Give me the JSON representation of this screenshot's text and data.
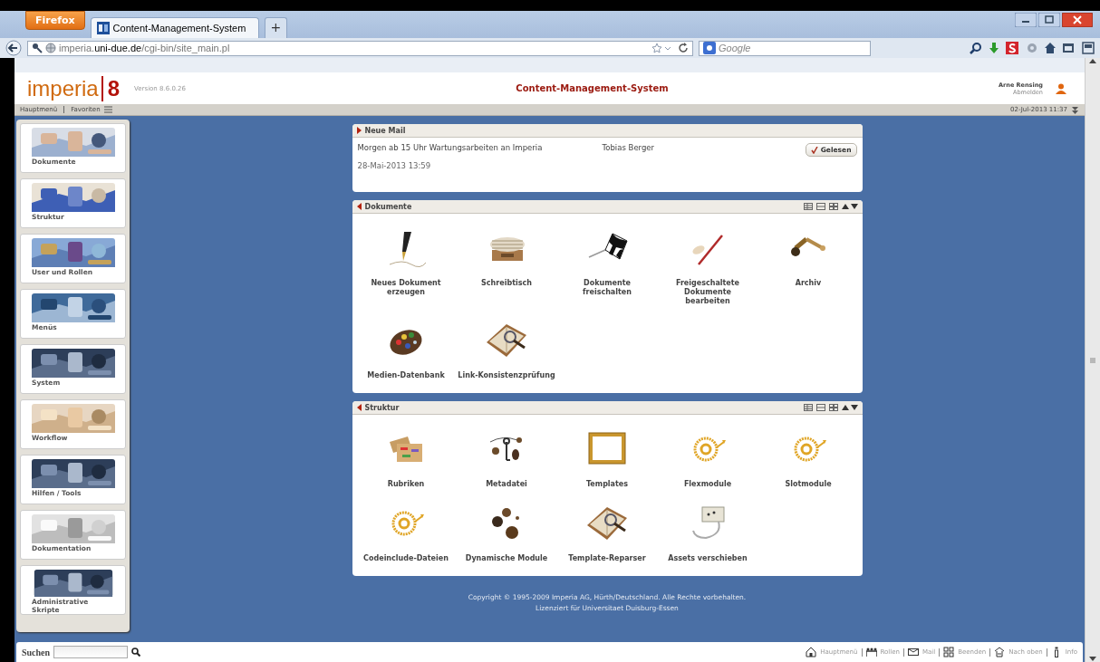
{
  "browser": {
    "menu_button": "Firefox",
    "tab_title": "Content-Management-System",
    "new_tab": "+",
    "url_host": "imperia.",
    "url_domain": "uni-due.de",
    "url_path": "/cgi-bin/site_main.pl",
    "search_placeholder": "Google"
  },
  "header": {
    "logo": "imperia",
    "logo_version": "8",
    "version": "Version 8.6.0.26",
    "title": "Content-Management-System",
    "user": "Arne Rensing",
    "logout": "Abmelden"
  },
  "nav": {
    "links": [
      "Hauptmenü",
      "Favoriten"
    ],
    "datetime": "02-Jul-2013 11:37"
  },
  "sidebar": {
    "items": [
      {
        "label": "Dokumente",
        "kind": "hands"
      },
      {
        "label": "Struktur",
        "kind": "cards"
      },
      {
        "label": "User und Rollen",
        "kind": "people"
      },
      {
        "label": "Menüs",
        "kind": "puzzle"
      },
      {
        "label": "System",
        "kind": "keyboard"
      },
      {
        "label": "Workflow",
        "kind": "child"
      },
      {
        "label": "Hilfen / Tools",
        "kind": "keyboard"
      },
      {
        "label": "Dokumentation",
        "kind": "paper"
      },
      {
        "label": "Administrative\nSkripte",
        "kind": "keyboard"
      }
    ]
  },
  "mail": {
    "title": "Neue Mail",
    "subject": "Morgen ab 15 Uhr Wartungsarbeiten an Imperia",
    "sender": "Tobias Berger",
    "date": "28-Mai-2013 13:59",
    "button": "Gelesen"
  },
  "panels": [
    {
      "title": "Dokumente",
      "items": [
        {
          "label": "Neues Dokument\nerzeugen",
          "kind": "pen"
        },
        {
          "label": "Schreibtisch",
          "kind": "papers"
        },
        {
          "label": "Dokumente\nfreischalten",
          "kind": "flag"
        },
        {
          "label": "Freigeschaltete\nDokumente\nbearbeiten",
          "kind": "pencil"
        },
        {
          "label": "Archiv",
          "kind": "spyglass"
        },
        {
          "label": "Medien-Datenbank",
          "kind": "palette"
        },
        {
          "label": "Link-Konsistenzprüfung",
          "kind": "book"
        }
      ]
    },
    {
      "title": "Struktur",
      "items": [
        {
          "label": "Rubriken",
          "kind": "cards"
        },
        {
          "label": "Metadatei",
          "kind": "keys"
        },
        {
          "label": "Templates",
          "kind": "frame"
        },
        {
          "label": "Flexmodule",
          "kind": "at"
        },
        {
          "label": "Slotmodule",
          "kind": "at"
        },
        {
          "label": "Codeinclude-Dateien",
          "kind": "at"
        },
        {
          "label": "Dynamische Module",
          "kind": "spheres"
        },
        {
          "label": "Template-Reparser",
          "kind": "book"
        },
        {
          "label": "Assets verschieben",
          "kind": "socket"
        }
      ]
    }
  ],
  "footer": {
    "lines": [
      "Copyright © 1995-2009 Imperia AG, Hürth/Deutschland. Alle Rechte vorbehalten.",
      "Lizenziert für Universitaet Duisburg-Essen"
    ]
  },
  "bottom": {
    "search_label": "Suchen",
    "links": [
      {
        "label": "Hauptmenü",
        "kind": "home"
      },
      {
        "label": "Rollen",
        "kind": "people"
      },
      {
        "label": "Mail",
        "kind": "mail"
      },
      {
        "label": "Beenden",
        "kind": "grid"
      },
      {
        "label": "Nach oben",
        "kind": "up"
      },
      {
        "label": "Info",
        "kind": "info"
      }
    ]
  }
}
